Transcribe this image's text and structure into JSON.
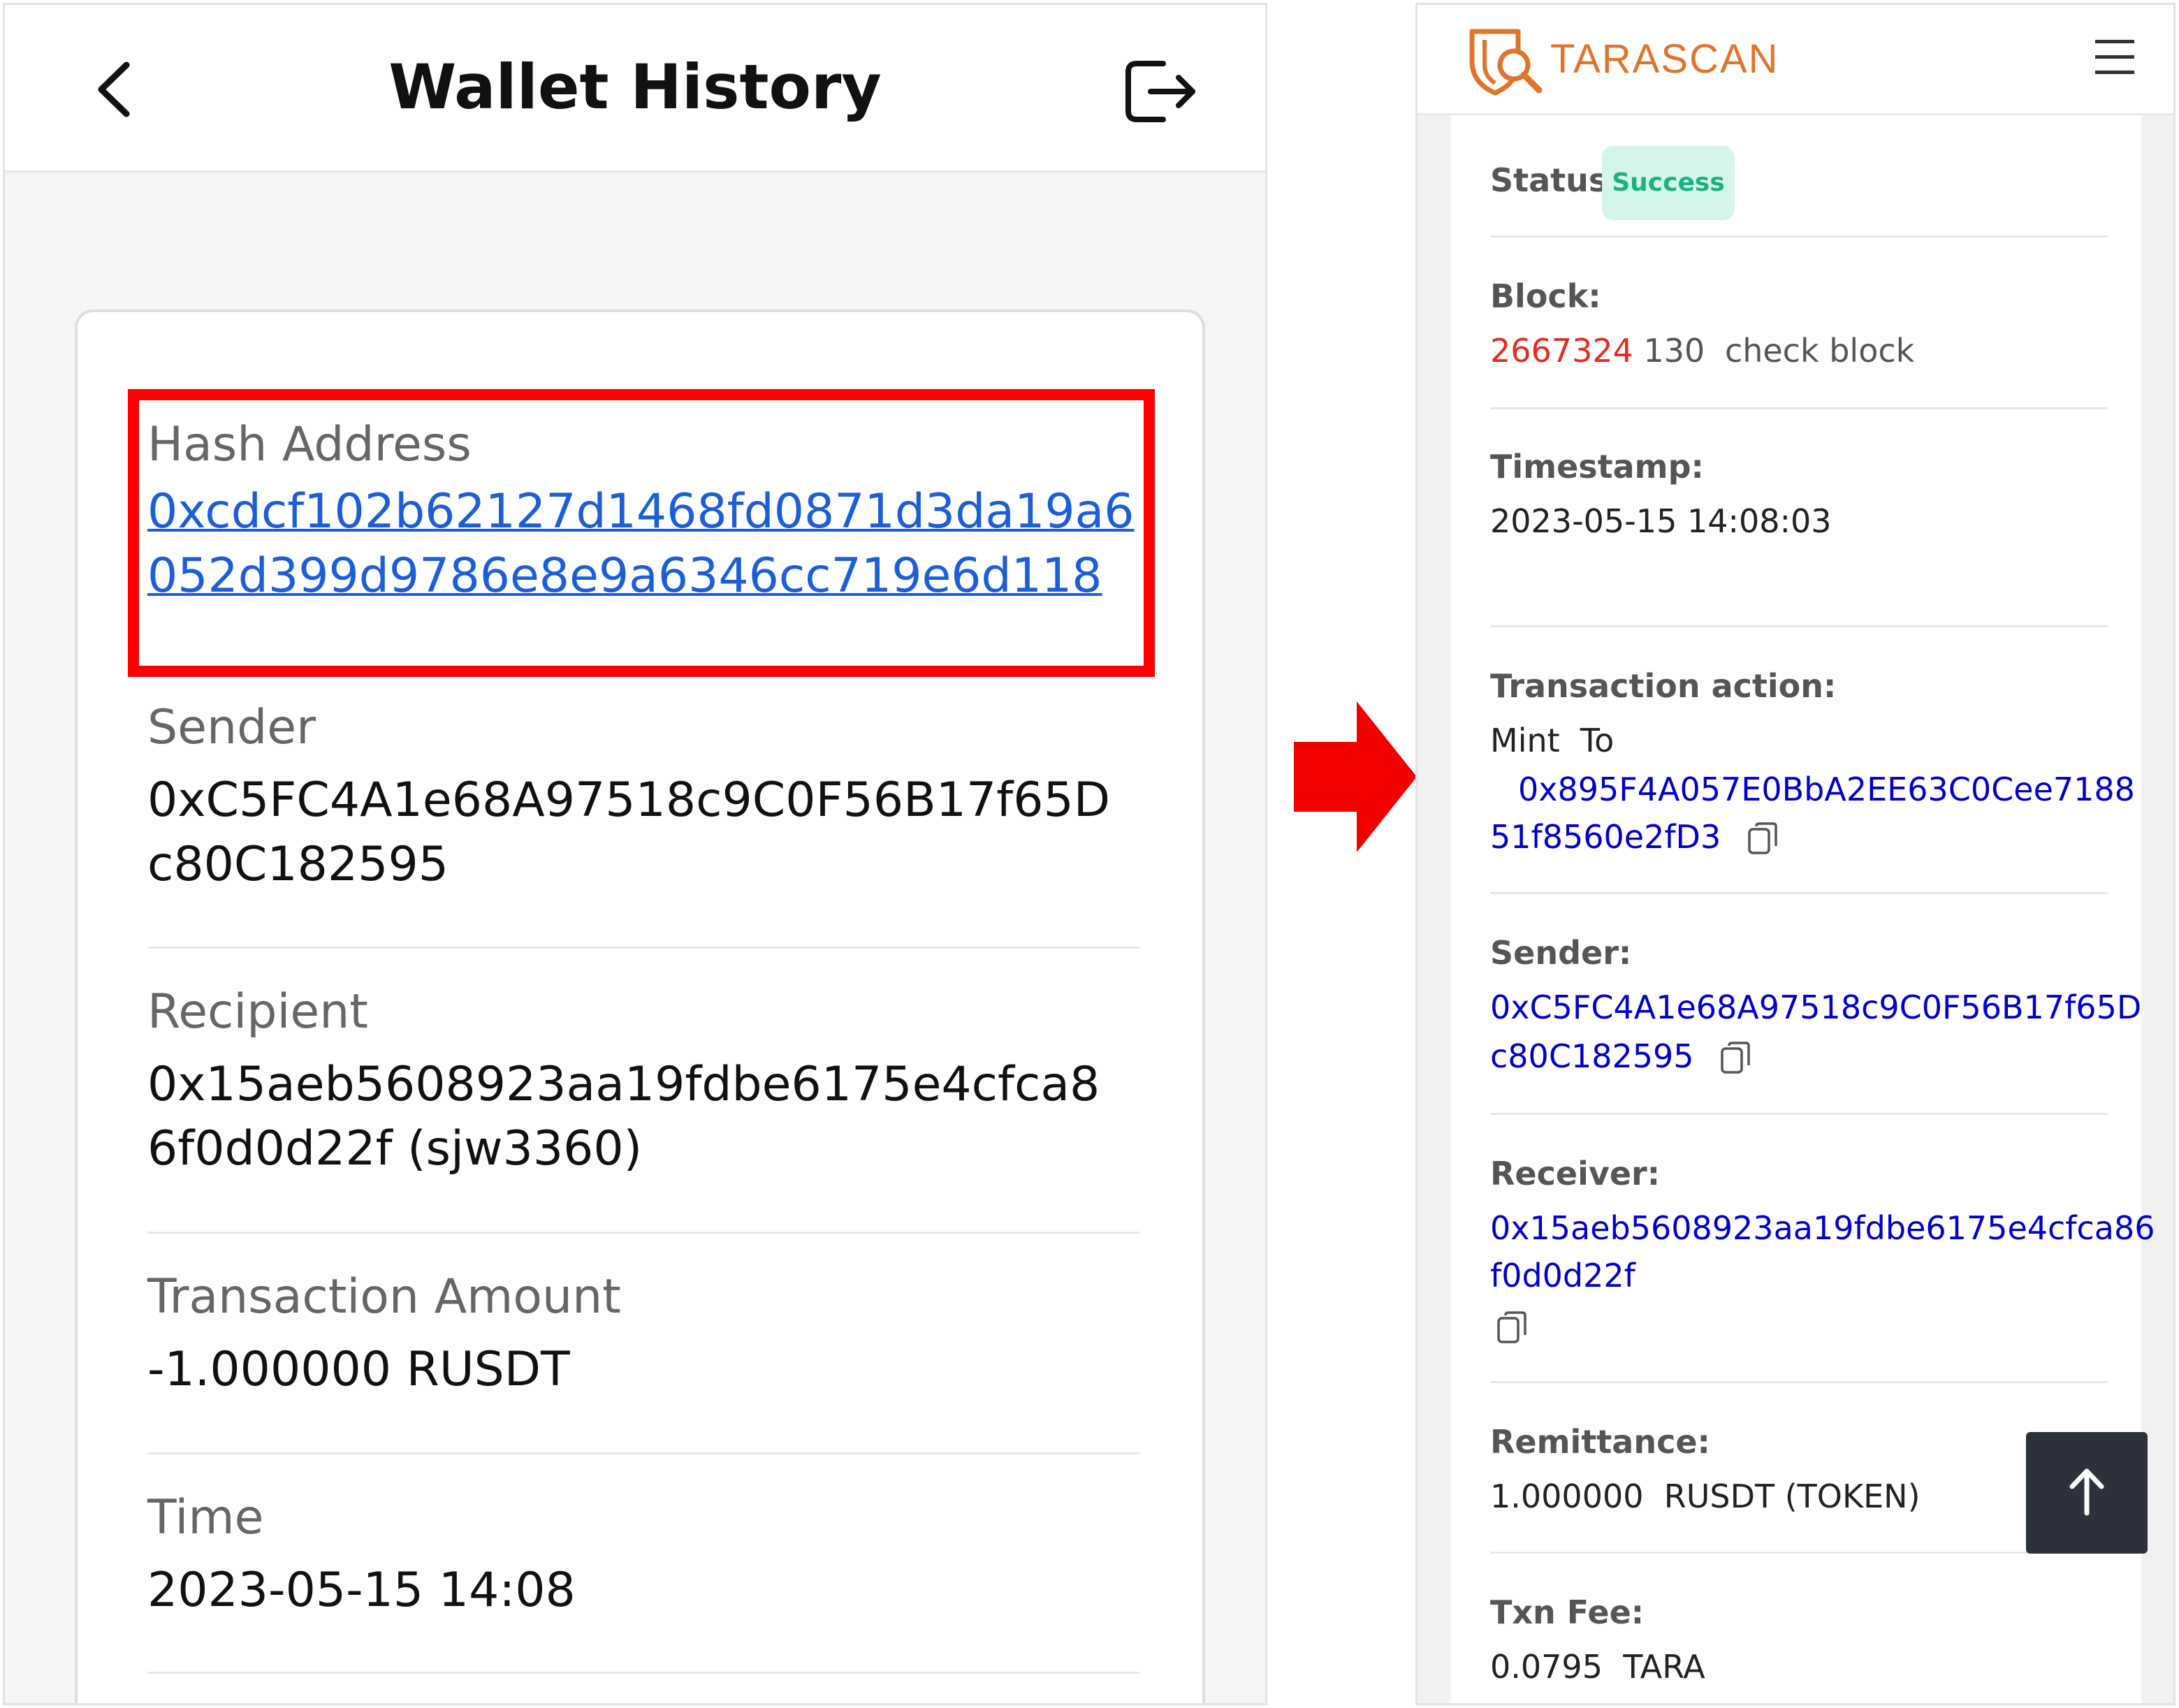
{
  "left": {
    "header": {
      "title": "Wallet History"
    },
    "hash": {
      "label": "Hash Address",
      "line1": "0xcdcf102b62127d1468fd0871d3da19a6",
      "line2": "052d399d9786e8e9a6346cc719e6d118"
    },
    "sender": {
      "label": "Sender",
      "line1": "0xC5FC4A1e68A97518c9C0F56B17f65D",
      "line2": "c80C182595"
    },
    "recipient": {
      "label": "Recipient",
      "line1": "0x15aeb5608923aa19fdbe6175e4cfca8",
      "line2": "6f0d0d22f (sjw3360)"
    },
    "amount": {
      "label": "Transaction Amount",
      "value": "-1.000000 RUSDT"
    },
    "time": {
      "label": "Time",
      "value": "2023-05-15 14:08"
    }
  },
  "right": {
    "brand": "TARASCAN",
    "status": {
      "label": "Status:",
      "badge": "Success"
    },
    "block": {
      "label": "Block:",
      "number": "2667324",
      "confirmations": "130",
      "link": "check block"
    },
    "timestamp": {
      "label": "Timestamp:",
      "value": "2023-05-15 14:08:03"
    },
    "action": {
      "label": "Transaction action:",
      "verb": "Mint  To",
      "line1": "0x895F4A057E0BbA2EE63C0Cee7188",
      "line2": "51f8560e2fD3"
    },
    "sender": {
      "label": "Sender:",
      "line1": "0xC5FC4A1e68A97518c9C0F56B17f65D",
      "line2": "c80C182595"
    },
    "receiver": {
      "label": "Receiver:",
      "line1": "0x15aeb5608923aa19fdbe6175e4cfca86",
      "line2": "f0d0d22f"
    },
    "remittance": {
      "label": "Remittance:",
      "value": "1.000000  RUSDT (TOKEN)"
    },
    "fee": {
      "label": "Txn Fee:",
      "value": "0.0795  TARA"
    }
  },
  "icons": {
    "back": "chevron-left-icon",
    "logout": "logout-icon",
    "flow": "arrow-right-icon",
    "brand": "tarascan-shield-search-icon",
    "menu": "hamburger-menu-icon",
    "copy": "copy-icon",
    "scroll_top": "arrow-up-icon"
  },
  "colors": {
    "highlight": "#ff0000",
    "link_left": "#1a5ed8",
    "link_right": "#0000cc",
    "brand": "#e0752a",
    "block_number": "#e52b1f",
    "success_bg": "#d3f5ea",
    "success_text": "#1bb27f"
  }
}
